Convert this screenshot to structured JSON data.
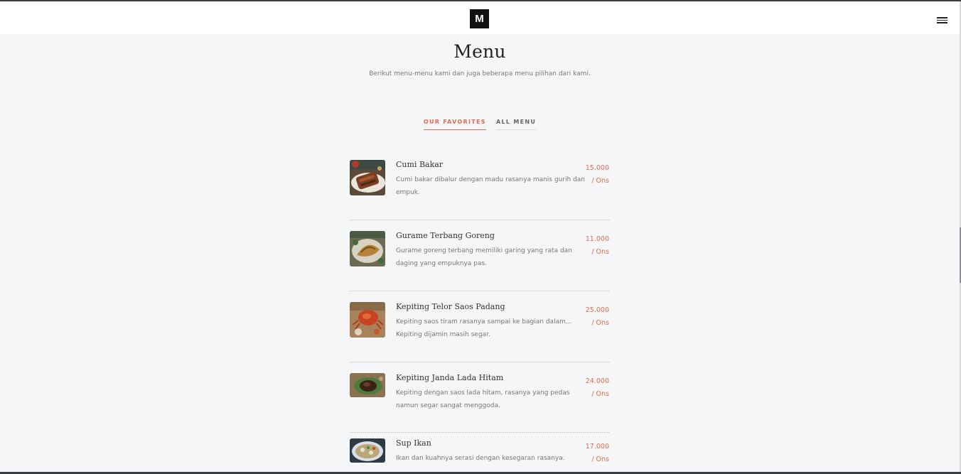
{
  "header": {
    "logo_text": "M",
    "menu_icon": "hamburger-icon"
  },
  "page": {
    "title": "Menu",
    "subtitle": "Berikut menu-menu kami dan juga beberapa menu pilihan dari kami."
  },
  "tabs": [
    {
      "label": "OUR FAVORITES",
      "active": true
    },
    {
      "label": "ALL MENU",
      "active": false
    }
  ],
  "menu_items": [
    {
      "name": "Cumi Bakar",
      "description": "Cumi bakar dibalur dengan madu rasanya manis gurih dan empuk.",
      "price": "15.000",
      "unit": "/ Ons",
      "image": "grilled-squid-photo"
    },
    {
      "name": "Gurame Terbang Goreng",
      "description": "Gurame goreng terbang memiliki garing yang rata dan daging yang empuknya pas.",
      "price": "11.000",
      "unit": "/ Ons",
      "image": "fried-fish-photo"
    },
    {
      "name": "Kepiting Telor Saos Padang",
      "description": "Kepiting saos tiram rasanya sampai ke bagian dalam... Kepiting dijamin masih segar.",
      "price": "25.000",
      "unit": "/ Ons",
      "image": "crab-padang-photo"
    },
    {
      "name": "Kepiting Janda Lada Hitam",
      "description": "Kepiting dengan saos lada hitam, rasanya yang pedas namun segar sangat menggoda.",
      "price": "24.000",
      "unit": "/ Ons",
      "image": "black-pepper-crab-photo"
    },
    {
      "name": "Sup Ikan",
      "description": "Ikan dan kuahnya serasi dengan kesegaran rasanya.",
      "price": "17.000",
      "unit": "/ Ons",
      "image": "fish-soup-photo"
    }
  ],
  "colors": {
    "accent": "#e06b4f",
    "background": "#f5f6f7",
    "header_bg": "#ffffff"
  }
}
